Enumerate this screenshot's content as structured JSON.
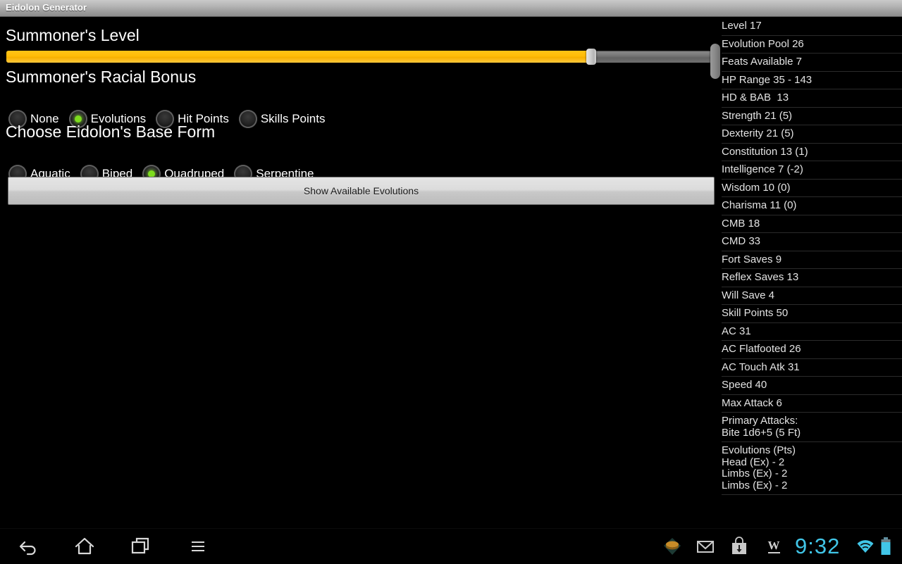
{
  "window": {
    "title": "Eidolon Generator"
  },
  "colors": {
    "accent_slider": "#ffbc07",
    "radio_selected": "#7ddc1e",
    "status_cyan": "#41c6e8",
    "background": "#000000",
    "titlebar_gray": "#b6b6b6"
  },
  "main": {
    "sections": {
      "level_heading": "Summoner's Level",
      "racial_heading": "Summoner's Racial Bonus",
      "form_heading": "Choose Eidolon's Base Form"
    },
    "slider": {
      "name": "summoners-level-slider",
      "percent": 83,
      "min": 1,
      "max": 20,
      "value": 17
    },
    "racial_bonus_options": [
      {
        "label": "None",
        "selected": false
      },
      {
        "label": "Evolutions",
        "selected": true
      },
      {
        "label": "Hit Points",
        "selected": false
      },
      {
        "label": "Skills Points",
        "selected": false
      }
    ],
    "base_form_options": [
      {
        "label": "Aquatic",
        "selected": false
      },
      {
        "label": "Biped",
        "selected": false
      },
      {
        "label": "Quadruped",
        "selected": true
      },
      {
        "label": "Serpentine",
        "selected": false
      }
    ],
    "show_evolutions_button": "Show Available Evolutions"
  },
  "stats_panel": {
    "items": [
      {
        "lines": [
          "Level 17"
        ]
      },
      {
        "lines": [
          "Evolution Pool 26"
        ]
      },
      {
        "lines": [
          "Feats Available 7"
        ]
      },
      {
        "lines": [
          "HP Range 35 - 143"
        ]
      },
      {
        "lines": [
          "HD & BAB  13"
        ]
      },
      {
        "lines": [
          "Strength 21 (5)"
        ]
      },
      {
        "lines": [
          "Dexterity 21 (5)"
        ]
      },
      {
        "lines": [
          "Constitution 13 (1)"
        ]
      },
      {
        "lines": [
          "Intelligence 7 (-2)"
        ]
      },
      {
        "lines": [
          "Wisdom 10 (0)"
        ]
      },
      {
        "lines": [
          "Charisma 11 (0)"
        ]
      },
      {
        "lines": [
          "CMB 18"
        ]
      },
      {
        "lines": [
          "CMD 33"
        ]
      },
      {
        "lines": [
          "Fort Saves 9"
        ]
      },
      {
        "lines": [
          "Reflex Saves 13"
        ]
      },
      {
        "lines": [
          "Will Save 4"
        ]
      },
      {
        "lines": [
          "Skill Points 50"
        ]
      },
      {
        "lines": [
          "AC 31"
        ]
      },
      {
        "lines": [
          "AC Flatfooted 26"
        ]
      },
      {
        "lines": [
          "AC Touch Atk 31"
        ]
      },
      {
        "lines": [
          "Speed 40"
        ]
      },
      {
        "lines": [
          "Max Attack 6"
        ]
      },
      {
        "lines": [
          "Primary Attacks:",
          "Bite 1d6+5 (5 Ft)"
        ]
      },
      {
        "lines": [
          "Evolutions (Pts)",
          "Head (Ex) - 2",
          "Limbs (Ex) - 2",
          "Limbs (Ex) - 2"
        ]
      }
    ]
  },
  "system_bar": {
    "nav": [
      {
        "name": "back-icon",
        "label": "Back"
      },
      {
        "name": "home-icon",
        "label": "Home"
      },
      {
        "name": "recents-icon",
        "label": "Recent apps"
      },
      {
        "name": "menu-icon",
        "label": "Menu"
      }
    ],
    "notifications": [
      {
        "name": "app-notification-icon",
        "label": "App"
      },
      {
        "name": "gmail-icon",
        "label": "Gmail"
      },
      {
        "name": "play-store-download-icon",
        "label": "Download"
      },
      {
        "name": "word-document-icon",
        "label": "W"
      }
    ],
    "clock": "9:32",
    "wifi": "wifi-icon",
    "battery": "battery-icon"
  }
}
